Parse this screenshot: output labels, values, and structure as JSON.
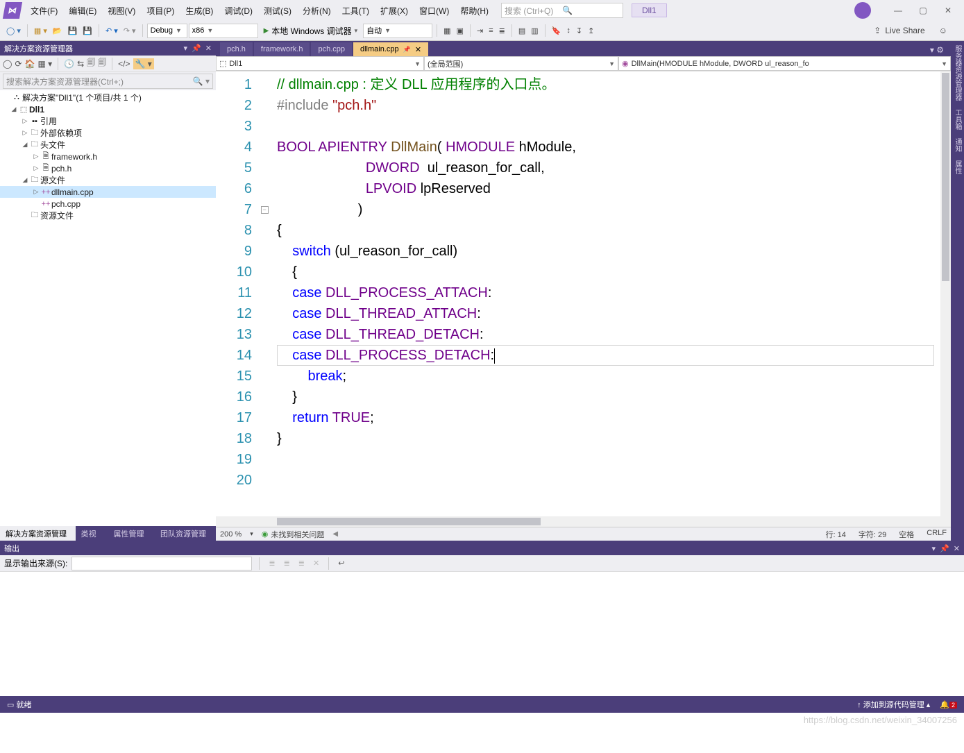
{
  "menu": {
    "items": [
      "文件(F)",
      "编辑(E)",
      "视图(V)",
      "项目(P)",
      "生成(B)",
      "调试(D)",
      "测试(S)",
      "分析(N)",
      "工具(T)",
      "扩展(X)",
      "窗口(W)",
      "帮助(H)"
    ]
  },
  "search": {
    "placeholder": "搜索 (Ctrl+Q)"
  },
  "project_badge": "Dll1",
  "toolbar": {
    "config": "Debug",
    "platform": "x86",
    "start": "本地 Windows 调试器",
    "auto": "自动"
  },
  "liveshare": "Live Share",
  "solution_explorer": {
    "title": "解决方案资源管理器",
    "search_placeholder": "搜索解决方案资源管理器(Ctrl+;)",
    "root": "解决方案\"Dll1\"(1 个项目/共 1 个)",
    "project": "Dll1",
    "refs": "引用",
    "external": "外部依赖项",
    "headers": "头文件",
    "h1": "framework.h",
    "h2": "pch.h",
    "sources": "源文件",
    "s1": "dllmain.cpp",
    "s2": "pch.cpp",
    "resources": "资源文件",
    "tabs": [
      "解决方案资源管理器",
      "类视图",
      "属性管理器",
      "团队资源管理器"
    ]
  },
  "doc_tabs": [
    "pch.h",
    "framework.h",
    "pch.cpp",
    "dllmain.cpp"
  ],
  "nav": {
    "scope1": "Dll1",
    "scope2": "(全局范围)",
    "scope3": "DllMain(HMODULE hModule, DWORD ul_reason_fo"
  },
  "lines": [
    "1",
    "2",
    "3",
    "4",
    "5",
    "6",
    "7",
    "8",
    "9",
    "10",
    "11",
    "12",
    "13",
    "14",
    "15",
    "16",
    "17",
    "18",
    "19",
    "20"
  ],
  "code": {
    "l1c": "// dllmain.cpp : 定义 DLL 应用程序的入口点。",
    "l2a": "#include ",
    "l2b": "\"pch.h\"",
    "l4a": "BOOL",
    "l4b": " APIENTRY ",
    "l4c": "DllMain",
    "l4d": "( ",
    "l4e": "HMODULE",
    "l4f": " hModule,",
    "l5a": "                       ",
    "l5b": "DWORD",
    "l5c": "  ul_reason_for_call,",
    "l6a": "                       ",
    "l6b": "LPVOID",
    "l6c": " lpReserved",
    "l7": "                     )",
    "l8": "{",
    "l9a": "    ",
    "l9b": "switch",
    "l9c": " (ul_reason_for_call)",
    "l10": "    {",
    "l11a": "    ",
    "l11b": "case",
    "l11c": " ",
    "l11d": "DLL_PROCESS_ATTACH",
    "l11e": ":",
    "l12a": "    ",
    "l12b": "case",
    "l12c": " ",
    "l12d": "DLL_THREAD_ATTACH",
    "l12e": ":",
    "l13a": "    ",
    "l13b": "case",
    "l13c": " ",
    "l13d": "DLL_THREAD_DETACH",
    "l13e": ":",
    "l14a": "    ",
    "l14b": "case",
    "l14c": " ",
    "l14d": "DLL_PROCESS_DETACH",
    "l14e": ":",
    "l15a": "        ",
    "l15b": "break",
    "l15c": ";",
    "l16": "    }",
    "l17a": "    ",
    "l17b": "return",
    "l17c": " ",
    "l17d": "TRUE",
    "l17e": ";",
    "l18": "}"
  },
  "ed_status": {
    "zoom": "200 %",
    "problems": "未找到相关问题",
    "line": "行: 14",
    "col": "字符: 29",
    "ins": "空格",
    "eol": "CRLF"
  },
  "right_tabs": [
    "服务器资源管理器",
    "工具箱",
    "通知",
    "属性"
  ],
  "output": {
    "title": "输出",
    "src_label": "显示输出来源(S):"
  },
  "status": {
    "ready": "就绪",
    "source": "↑ 添加到源代码管理 ▴",
    "notif_count": "2"
  },
  "watermark": "https://blog.csdn.net/weixin_34007256"
}
